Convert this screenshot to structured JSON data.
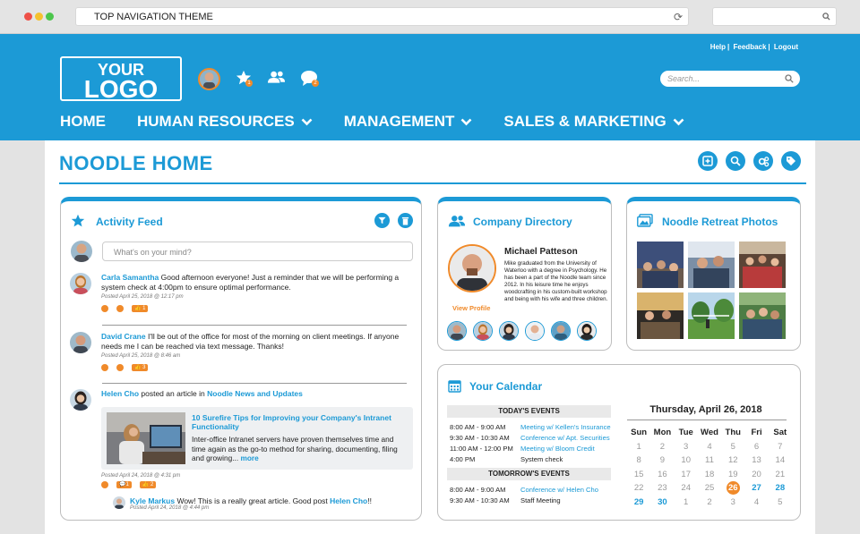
{
  "browser": {
    "url_text": "TOP NAVIGATION THEME"
  },
  "header": {
    "links": [
      "Help",
      "Feedback",
      "Logout"
    ],
    "logo_line1": "YOUR",
    "logo_line2": "LOGO",
    "favorites_badge": "1",
    "messages_badge": "2",
    "search_placeholder": "Search..."
  },
  "nav": [
    "HOME",
    "HUMAN RESOURCES",
    "MANAGEMENT",
    "SALES & MARKETING"
  ],
  "page": {
    "title": "NOODLE HOME"
  },
  "activity": {
    "title": "Activity Feed",
    "composer_placeholder": "What's on your mind?",
    "posts": [
      {
        "name": "Carla Samantha",
        "text": " Good afternoon everyone! Just a reminder that we will be performing a system check at 4:00pm to ensure optimal performance.",
        "meta": "Posted April 25, 2018 @ 12:17 pm",
        "likes": "1"
      },
      {
        "name": "David Crane",
        "text": " I'll be out of the office for most of the morning on client meetings. If anyone needs me I can be reached via text message. Thanks!",
        "meta": "Posted April 25, 2018 @ 8:46 am",
        "likes": "3"
      },
      {
        "name": "Helen Cho",
        "text": " posted an article in ",
        "group": "Noodle News and Updates",
        "meta": "Posted April 24, 2018 @ 4:31 pm",
        "comments": "1",
        "likes": "2"
      }
    ],
    "article": {
      "title": "10 Surefire Tips for Improving your Company's Intranet Functionality",
      "text": "Inter-office Intranet servers have proven themselves time and time again as the go-to method for sharing, documenting, filing and growing...",
      "more": "more"
    },
    "reply": {
      "name": "Kyle Markus",
      "text": " Wow! This is a really great article. Good post ",
      "mention": "Helen Cho",
      "tail": "!!",
      "meta": "Posted April 24, 2018 @ 4:44 pm"
    }
  },
  "directory": {
    "title": "Company Directory",
    "name": "Michael Patteson",
    "bio": "Mike graduated from the University of Waterloo with a degree in Psychology. He has been a part of the Noodle team since 2012. In his leisure time he enjoys woodcrafting in his custom-built workshop and being with his wife and three children.",
    "view_profile": "View Profile"
  },
  "photos": {
    "title": "Noodle Retreat Photos"
  },
  "calendar": {
    "title": "Your Calendar",
    "today_label": "TODAY'S EVENTS",
    "today_events": [
      {
        "time": "8:00 AM - 9:00 AM",
        "event": "Meeting w/ Kellen's Insurance",
        "link": true
      },
      {
        "time": "9:30 AM - 10:30 AM",
        "event": "Conference w/ Apt. Securities",
        "link": true
      },
      {
        "time": "11:00 AM - 12:00 PM",
        "event": "Meeting w/ Bloom Credit",
        "link": true
      },
      {
        "time": "4:00 PM",
        "event": "System check",
        "link": false
      }
    ],
    "tomorrow_label": "TOMORROW'S EVENTS",
    "tomorrow_events": [
      {
        "time": "8:00 AM - 9:00 AM",
        "event": "Conference w/ Helen Cho",
        "link": true
      },
      {
        "time": "9:30 AM - 10:30 AM",
        "event": "Staff Meeting",
        "link": false
      }
    ],
    "date_title": "Thursday, April 26, 2018",
    "weekdays": [
      "Sun",
      "Mon",
      "Tue",
      "Wed",
      "Thu",
      "Fri",
      "Sat"
    ],
    "weeks": [
      [
        "1",
        "2",
        "3",
        "4",
        "5",
        "6",
        "7"
      ],
      [
        "8",
        "9",
        "10",
        "11",
        "12",
        "13",
        "14"
      ],
      [
        "15",
        "16",
        "17",
        "18",
        "19",
        "20",
        "21"
      ],
      [
        "22",
        "23",
        "24",
        "25",
        "26",
        "27",
        "28"
      ],
      [
        "29",
        "30",
        "1",
        "2",
        "3",
        "4",
        "5"
      ]
    ],
    "today": "26",
    "colors": {
      "accent": "#1c9ad6",
      "highlight": "#f08a2a"
    }
  }
}
